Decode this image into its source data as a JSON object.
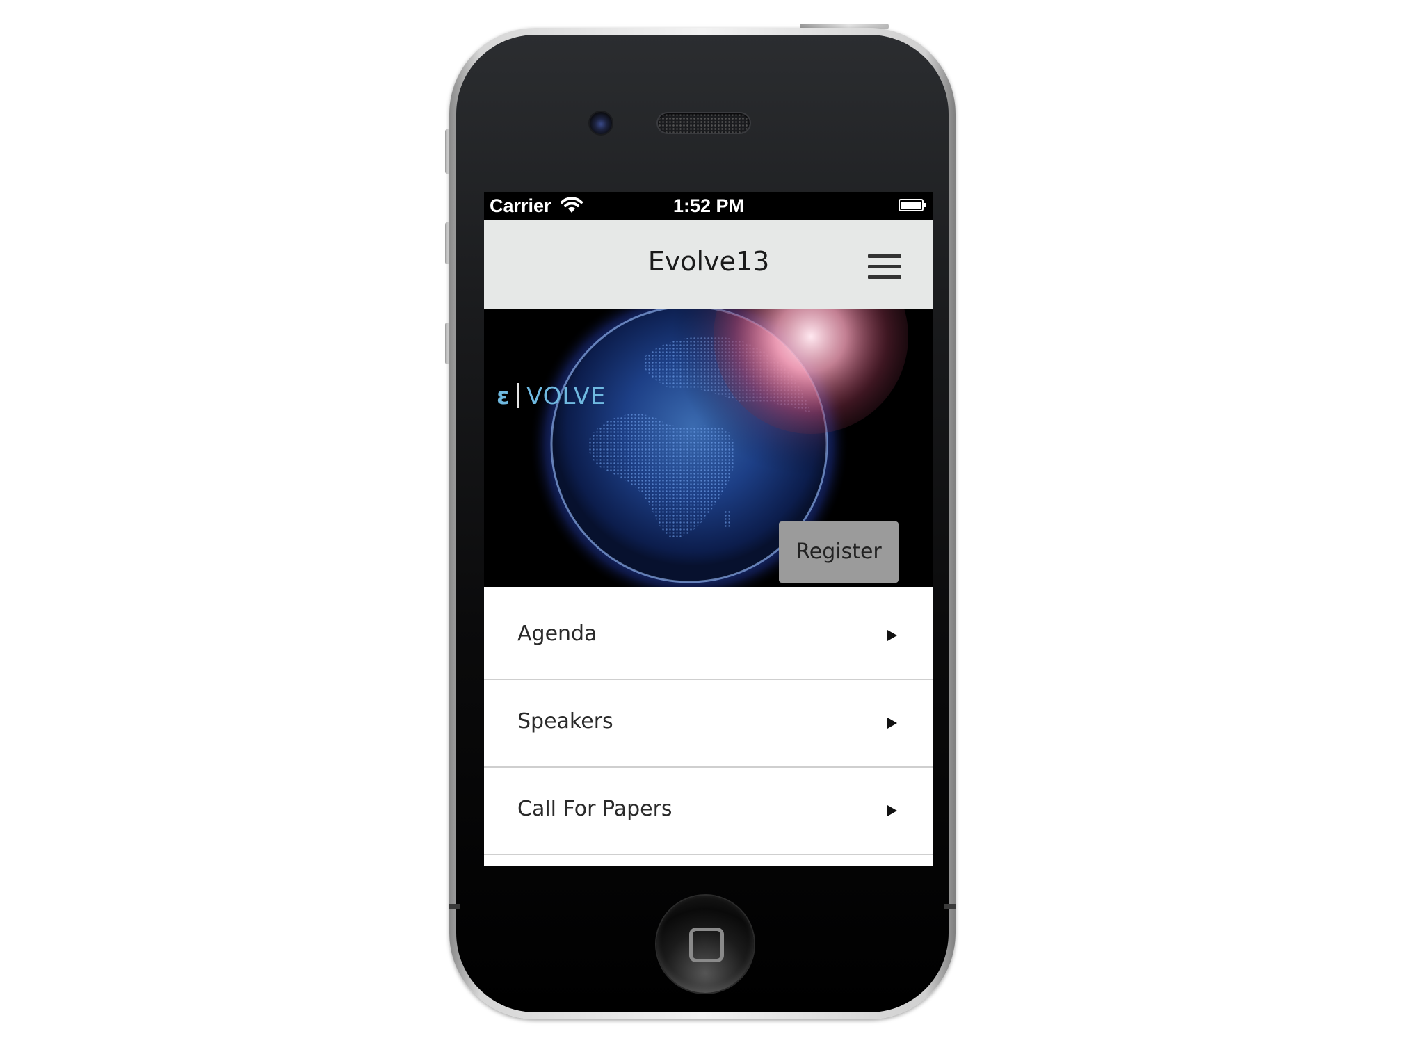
{
  "status_bar": {
    "carrier": "Carrier",
    "time": "1:52 PM",
    "wifi_icon": "wifi-icon",
    "battery_icon": "battery-icon"
  },
  "header": {
    "title": "Evolve13",
    "menu_icon": "hamburger-menu-icon"
  },
  "hero": {
    "logo_mark": "ε",
    "logo_text": "VOLVE",
    "register_label": "Register"
  },
  "menu": {
    "items": [
      {
        "label": "Agenda",
        "icon": "arrow-right-icon"
      },
      {
        "label": "Speakers",
        "icon": "arrow-right-icon"
      },
      {
        "label": "Call For Papers",
        "icon": "arrow-right-icon"
      }
    ]
  },
  "colors": {
    "header_bg": "#e6e8e7",
    "register_bg": "#9b9b9b",
    "logo_accent": "#6fb9e0",
    "status_bar_bg": "#000000"
  }
}
